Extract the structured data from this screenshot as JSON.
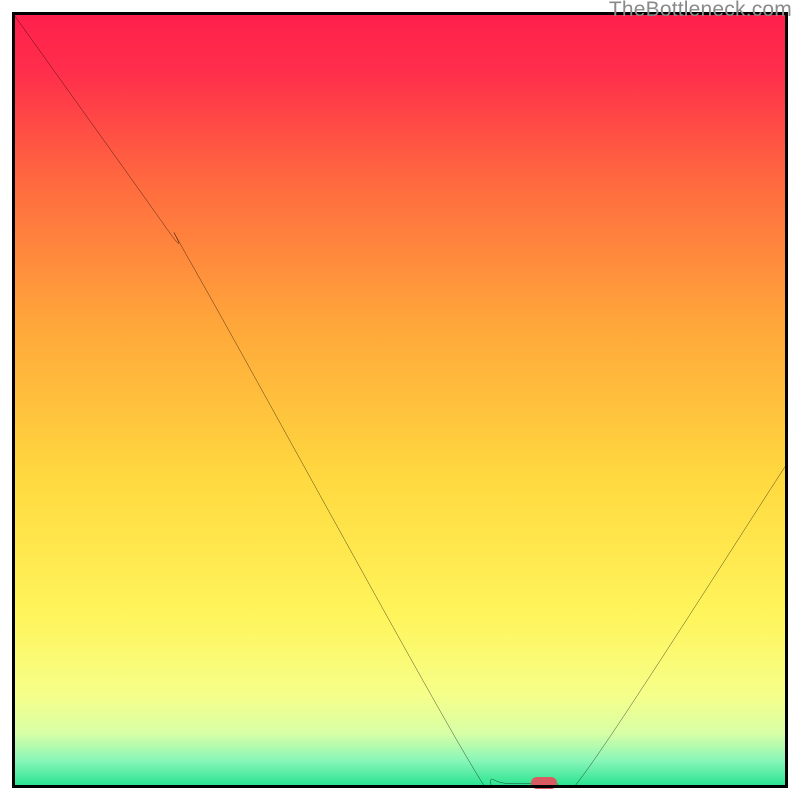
{
  "watermark": "TheBottleneck.com",
  "chart_data": {
    "type": "line",
    "title": "",
    "xlabel": "",
    "ylabel": "",
    "xlim": [
      0,
      100
    ],
    "ylim": [
      0,
      100
    ],
    "background_gradient": {
      "stops": [
        {
          "pos": 0.0,
          "color": "#ff1f4b"
        },
        {
          "pos": 0.08,
          "color": "#ff2f4b"
        },
        {
          "pos": 0.22,
          "color": "#ff6a3f"
        },
        {
          "pos": 0.4,
          "color": "#ffa63a"
        },
        {
          "pos": 0.6,
          "color": "#ffd93f"
        },
        {
          "pos": 0.78,
          "color": "#fff55c"
        },
        {
          "pos": 0.88,
          "color": "#f6ff8a"
        },
        {
          "pos": 0.93,
          "color": "#d7ffa6"
        },
        {
          "pos": 0.965,
          "color": "#88f6b8"
        },
        {
          "pos": 1.0,
          "color": "#21e28d"
        }
      ]
    },
    "curve": {
      "points": [
        {
          "x": 0,
          "y": 100
        },
        {
          "x": 20,
          "y": 72
        },
        {
          "x": 24,
          "y": 66
        },
        {
          "x": 58,
          "y": 5
        },
        {
          "x": 62,
          "y": 1.1
        },
        {
          "x": 66,
          "y": 0.6
        },
        {
          "x": 70,
          "y": 0.6
        },
        {
          "x": 74,
          "y": 2.2
        },
        {
          "x": 100,
          "y": 42
        }
      ],
      "min_marker": {
        "x": 68.5,
        "y": 0.6,
        "color": "#d95b62"
      }
    }
  }
}
